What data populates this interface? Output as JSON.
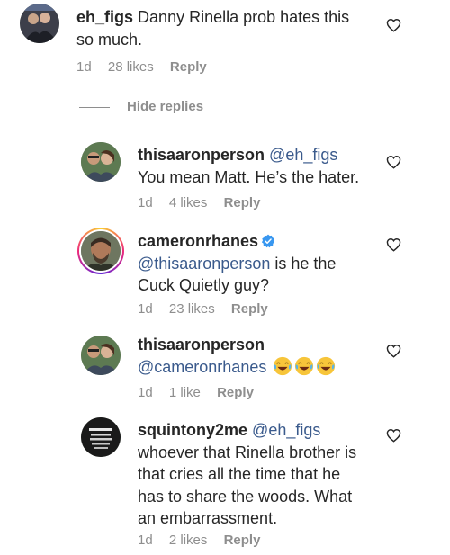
{
  "comments": [
    {
      "username": "eh_figs",
      "text": "Danny Rinella prob hates this so much.",
      "line1": "Danny Rinella prob hates this",
      "line2": "so much.",
      "time": "1d",
      "likes": "28 likes",
      "reply": "Reply"
    },
    {
      "username": "thisaaronperson",
      "mention": "@eh_figs",
      "text": "You mean Matt. He’s the hater.",
      "time": "1d",
      "likes": "4 likes",
      "reply": "Reply"
    },
    {
      "username": "cameronrhanes",
      "verified": true,
      "mention": "@thisaaronperson",
      "text_after_mention": " is he the",
      "line2": "Cuck Quietly guy?",
      "time": "1d",
      "likes": "23 likes",
      "reply": "Reply"
    },
    {
      "username": "thisaaronperson",
      "mention": "@cameronrhanes",
      "emoji": "😂😂😂",
      "time": "1d",
      "likes": "1 like",
      "reply": "Reply"
    },
    {
      "username": "squintony2me",
      "mention": "@eh_figs",
      "line1": "whoever that Rinella brother is",
      "line2": "that cries all the time that he",
      "line3": "has to share the woods. What",
      "line4": "an embarrassment.",
      "time": "1d",
      "likes": "2 likes",
      "reply": "Reply"
    }
  ],
  "hide_replies_label": "Hide replies",
  "colors": {
    "text": "#262626",
    "meta": "#8e8e8e",
    "mention": "#3a5a8c",
    "verified": "#3897f0"
  },
  "icons": {
    "heart": "heart-outline-icon",
    "verified": "verified-badge-icon",
    "emoji": "face-with-tears-of-joy"
  }
}
